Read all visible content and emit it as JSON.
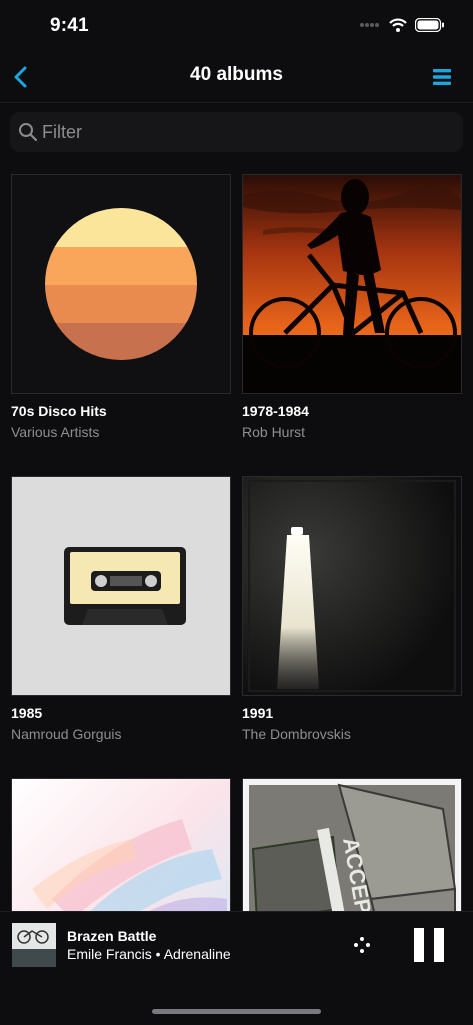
{
  "status_bar": {
    "time": "9:41"
  },
  "nav": {
    "title": "40 albums"
  },
  "search": {
    "placeholder": "Filter"
  },
  "albums": [
    {
      "title": "70s Disco Hits",
      "artist": "Various Artists"
    },
    {
      "title": "1978-1984",
      "artist": "Rob Hurst"
    },
    {
      "title": "1985",
      "artist": "Namroud Gorguis"
    },
    {
      "title": "1991",
      "artist": "The Dombrovskis"
    },
    {
      "title": "",
      "artist": ""
    },
    {
      "title": "",
      "artist": ""
    }
  ],
  "now_playing": {
    "title": "Brazen Battle",
    "artist": "Emile Francis",
    "album": "Adrenaline",
    "separator": " • "
  },
  "colors": {
    "accent": "#1aa7df",
    "background": "#0d0d0f",
    "secondary_text": "#8e8e93"
  }
}
